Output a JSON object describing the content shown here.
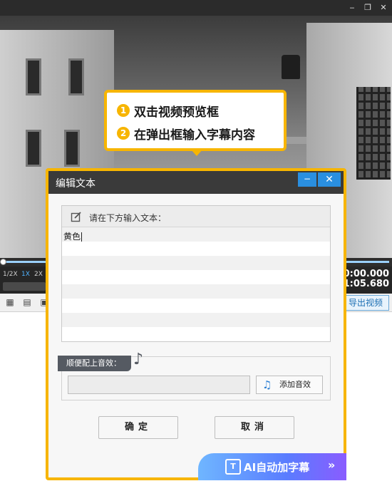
{
  "window": {
    "min_icon": "minimize-icon",
    "restore_icon": "restore-icon",
    "close_icon": "close-icon",
    "min_glyph": "‒",
    "restore_glyph": "❐",
    "close_glyph": "✕"
  },
  "callout": {
    "steps": [
      {
        "num": "1",
        "text": "双击视频预览框"
      },
      {
        "num": "2",
        "text": "在弹出框输入字幕内容"
      }
    ],
    "accent": "#f7b500"
  },
  "player": {
    "speeds": [
      "1/2X",
      "1X",
      "2X"
    ],
    "active_speed": "1X",
    "time_current": "00:00.000",
    "time_total": "01:05.680",
    "progress": 0
  },
  "toolbar": {
    "export_label": "导出视频"
  },
  "dialog": {
    "title": "编辑文本",
    "min_glyph": "−",
    "close_glyph": "✕",
    "editor_label": "请在下方输入文本：",
    "editor_value": "黄色",
    "sound_label": "顺便配上音效：",
    "sound_value": "",
    "add_sound_label": "添加音效",
    "ok_label": "确定",
    "cancel_label": "取消",
    "ai_label": "AI自动加字幕",
    "ai_arrow": "»"
  },
  "colors": {
    "accent": "#f7b500",
    "title_blue": "#2a8fe0",
    "ai_start": "#6fb6ff",
    "ai_end": "#8a5cff"
  }
}
